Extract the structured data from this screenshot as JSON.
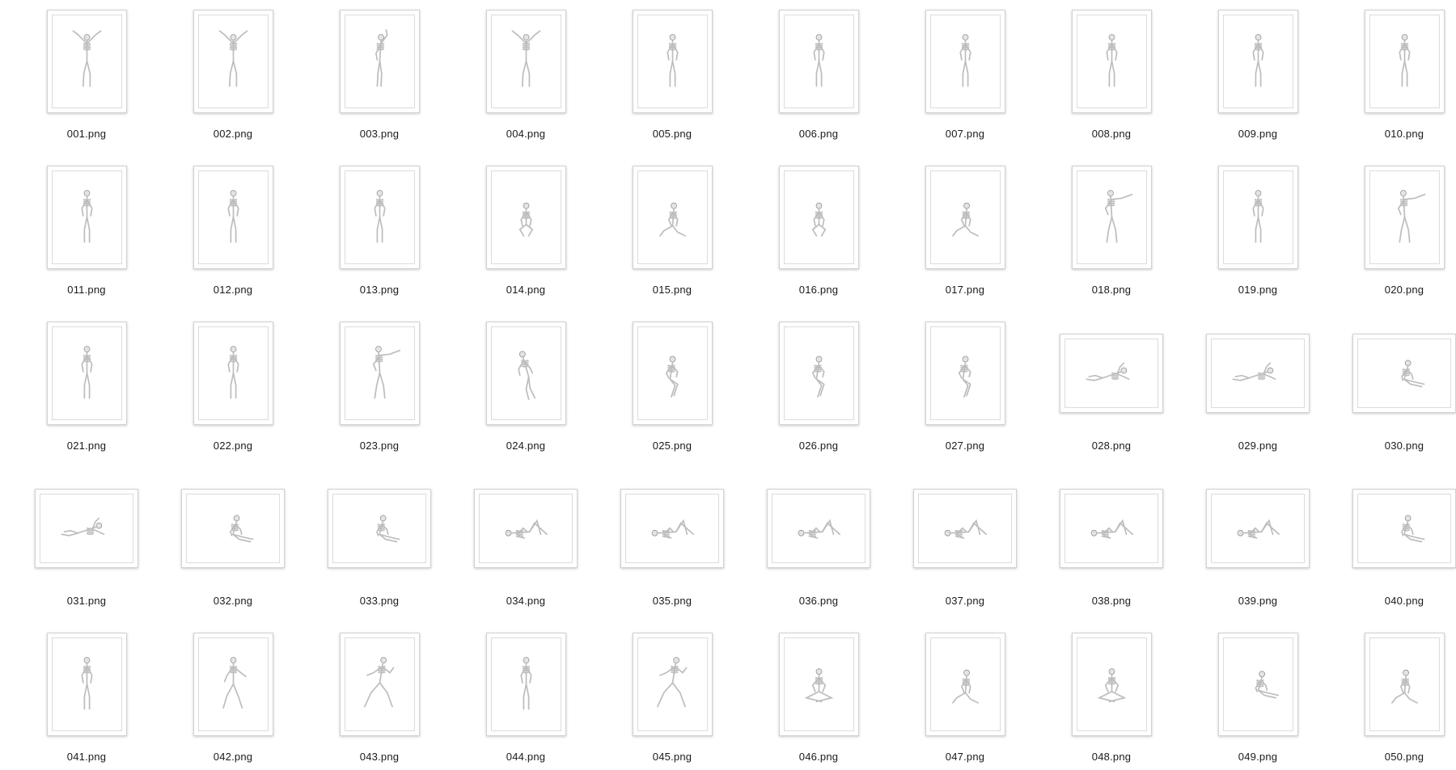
{
  "files": [
    {
      "name": "001.png",
      "pose": "arms-up"
    },
    {
      "name": "002.png",
      "pose": "arms-up"
    },
    {
      "name": "003.png",
      "pose": "one-arm-up"
    },
    {
      "name": "004.png",
      "pose": "arms-up"
    },
    {
      "name": "005.png",
      "pose": "standing"
    },
    {
      "name": "006.png",
      "pose": "standing"
    },
    {
      "name": "007.png",
      "pose": "standing"
    },
    {
      "name": "008.png",
      "pose": "standing"
    },
    {
      "name": "009.png",
      "pose": "standing"
    },
    {
      "name": "010.png",
      "pose": "standing"
    },
    {
      "name": "011.png",
      "pose": "standing"
    },
    {
      "name": "012.png",
      "pose": "standing"
    },
    {
      "name": "013.png",
      "pose": "standing"
    },
    {
      "name": "014.png",
      "pose": "crouching"
    },
    {
      "name": "015.png",
      "pose": "kneeling"
    },
    {
      "name": "016.png",
      "pose": "crouching"
    },
    {
      "name": "017.png",
      "pose": "kneeling"
    },
    {
      "name": "018.png",
      "pose": "arm-out"
    },
    {
      "name": "019.png",
      "pose": "standing"
    },
    {
      "name": "020.png",
      "pose": "arm-out"
    },
    {
      "name": "021.png",
      "pose": "standing"
    },
    {
      "name": "022.png",
      "pose": "standing"
    },
    {
      "name": "023.png",
      "pose": "arm-out"
    },
    {
      "name": "024.png",
      "pose": "leaning"
    },
    {
      "name": "025.png",
      "pose": "sitting"
    },
    {
      "name": "026.png",
      "pose": "sitting"
    },
    {
      "name": "027.png",
      "pose": "sitting"
    },
    {
      "name": "028.png",
      "pose": "lying"
    },
    {
      "name": "029.png",
      "pose": "lying"
    },
    {
      "name": "030.png",
      "pose": "sitting-floor"
    },
    {
      "name": "031.png",
      "pose": "lying"
    },
    {
      "name": "032.png",
      "pose": "sitting-floor"
    },
    {
      "name": "033.png",
      "pose": "sitting-floor"
    },
    {
      "name": "034.png",
      "pose": "lying-back"
    },
    {
      "name": "035.png",
      "pose": "lying-back"
    },
    {
      "name": "036.png",
      "pose": "lying-back"
    },
    {
      "name": "037.png",
      "pose": "lying-back"
    },
    {
      "name": "038.png",
      "pose": "lying-back"
    },
    {
      "name": "039.png",
      "pose": "lying-back"
    },
    {
      "name": "040.png",
      "pose": "sitting-floor"
    },
    {
      "name": "041.png",
      "pose": "standing"
    },
    {
      "name": "042.png",
      "pose": "walking"
    },
    {
      "name": "043.png",
      "pose": "running"
    },
    {
      "name": "044.png",
      "pose": "standing"
    },
    {
      "name": "045.png",
      "pose": "running"
    },
    {
      "name": "046.png",
      "pose": "cross-legged"
    },
    {
      "name": "047.png",
      "pose": "kneeling"
    },
    {
      "name": "048.png",
      "pose": "cross-legged"
    },
    {
      "name": "049.png",
      "pose": "sitting-floor"
    },
    {
      "name": "050.png",
      "pose": "kneeling"
    }
  ],
  "colors": {
    "background": "#ffffff",
    "label": "#1a1a1a",
    "bone": "#bdbdbd",
    "bone_dark": "#8f8f8f"
  }
}
